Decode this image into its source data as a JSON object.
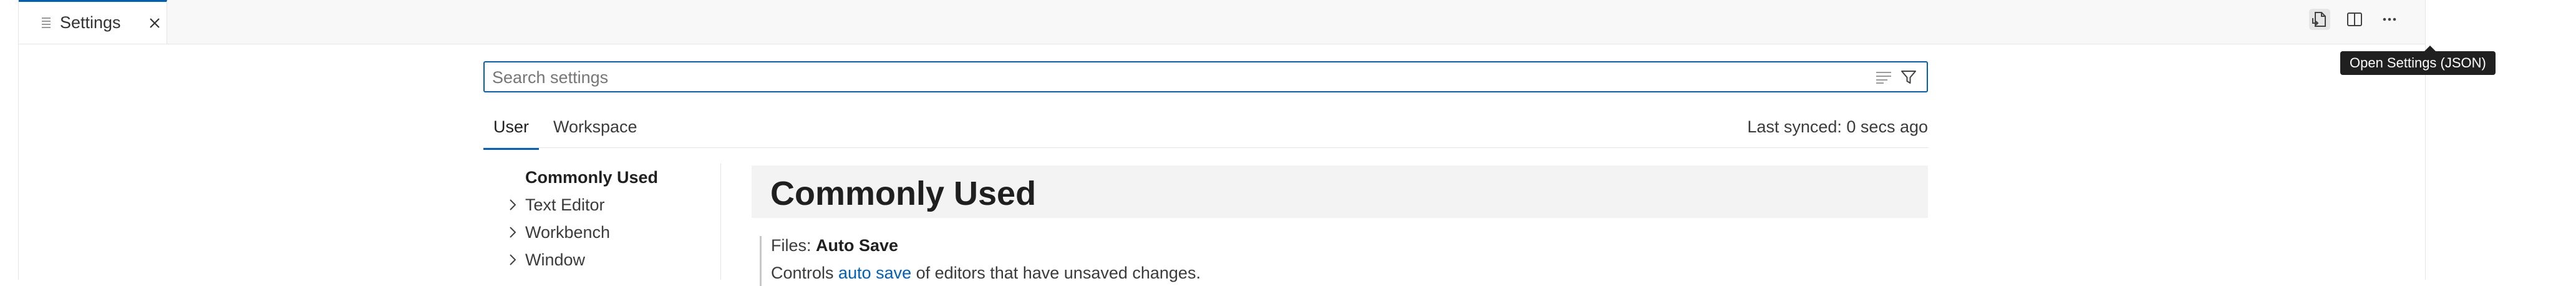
{
  "tab": {
    "label": "Settings"
  },
  "tooltip": "Open Settings (JSON)",
  "search": {
    "placeholder": "Search settings",
    "value": ""
  },
  "scopes": [
    {
      "label": "User"
    },
    {
      "label": "Workspace"
    }
  ],
  "sync_status": "Last synced: 0 secs ago",
  "toc": [
    {
      "label": "Commonly Used"
    },
    {
      "label": "Text Editor"
    },
    {
      "label": "Workbench"
    },
    {
      "label": "Window"
    }
  ],
  "section_title": "Commonly Used",
  "setting": {
    "category": "Files: ",
    "name": "Auto Save",
    "desc_before": "Controls ",
    "desc_link": "auto save",
    "desc_after": " of editors that have unsaved changes."
  },
  "colors": {
    "accent": "#005fb8",
    "tooltip_bg": "#202020",
    "header_bg": "#f3f3f3"
  },
  "icons": [
    "file-icon",
    "close-icon",
    "open-json-icon",
    "split-editor-icon",
    "more-actions-icon",
    "clear-filter-icon",
    "filter-icon",
    "chevron-right-icon"
  ]
}
